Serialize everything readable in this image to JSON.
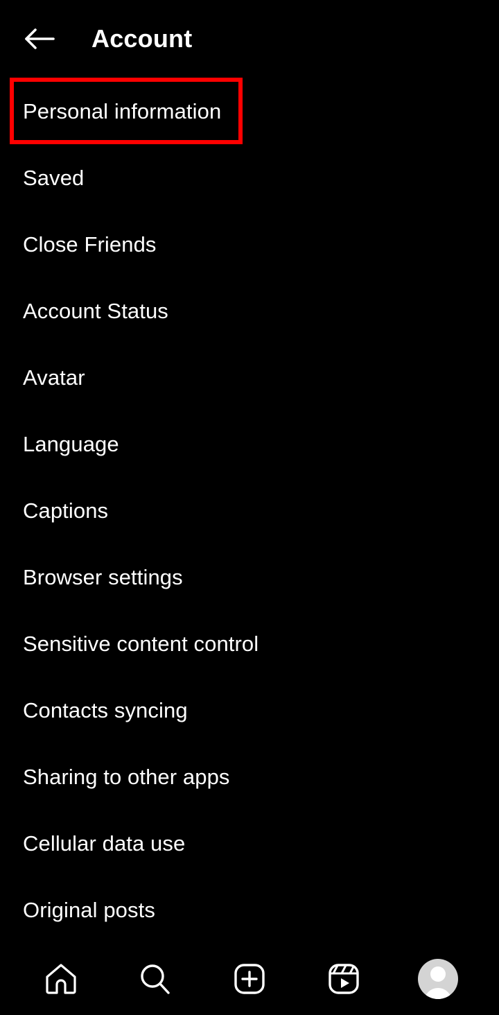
{
  "header": {
    "back_icon": "arrow-left-icon",
    "title": "Account"
  },
  "settings_list": {
    "items": [
      {
        "label": "Personal information",
        "highlighted": true
      },
      {
        "label": "Saved",
        "highlighted": false
      },
      {
        "label": "Close Friends",
        "highlighted": false
      },
      {
        "label": "Account Status",
        "highlighted": false
      },
      {
        "label": "Avatar",
        "highlighted": false
      },
      {
        "label": "Language",
        "highlighted": false
      },
      {
        "label": "Captions",
        "highlighted": false
      },
      {
        "label": "Browser settings",
        "highlighted": false
      },
      {
        "label": "Sensitive content control",
        "highlighted": false
      },
      {
        "label": "Contacts syncing",
        "highlighted": false
      },
      {
        "label": "Sharing to other apps",
        "highlighted": false
      },
      {
        "label": "Cellular data use",
        "highlighted": false
      },
      {
        "label": "Original posts",
        "highlighted": false
      }
    ]
  },
  "highlight": {
    "color": "#ff0000",
    "target": "Personal information"
  },
  "bottom_nav": {
    "items": [
      {
        "icon": "home-icon",
        "name": "nav-home"
      },
      {
        "icon": "search-icon",
        "name": "nav-search"
      },
      {
        "icon": "create-plus-icon",
        "name": "nav-create"
      },
      {
        "icon": "reels-icon",
        "name": "nav-reels"
      },
      {
        "icon": "profile-avatar-icon",
        "name": "nav-profile"
      }
    ]
  },
  "colors": {
    "background": "#000000",
    "text": "#ffffff",
    "accent": "#ff0000",
    "avatar_bg": "#d4d4d4"
  }
}
